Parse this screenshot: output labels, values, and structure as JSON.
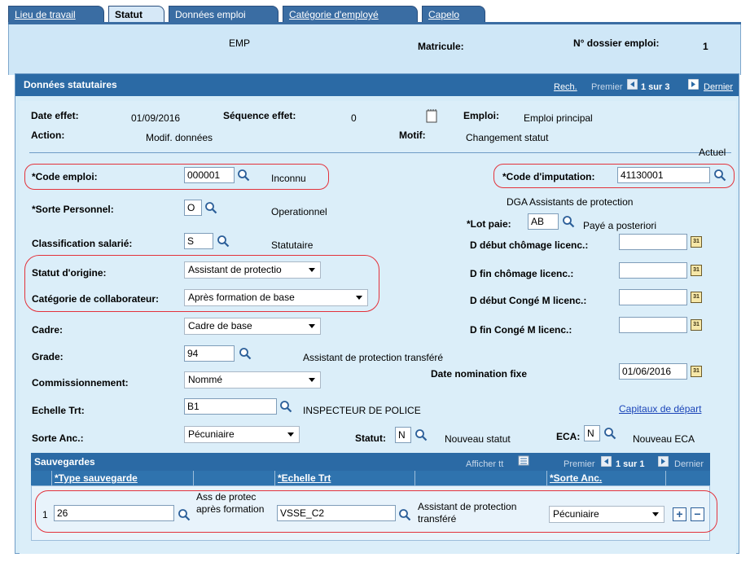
{
  "tabs": [
    "Lieu de travail",
    "Statut",
    "Données emploi",
    "Catégorie d'employé",
    "Capelo"
  ],
  "header": {
    "emp": "EMP",
    "matricule_label": "Matricule:",
    "dossier_label": "N° dossier emploi:",
    "dossier_value": "1"
  },
  "panel": {
    "title": "Données statutaires",
    "rech": "Rech.",
    "premier": "Premier",
    "range": "1 sur 3",
    "dernier": "Dernier"
  },
  "top": {
    "date_effet_label": "Date effet:",
    "date_effet_value": "01/09/2016",
    "sequence_label": "Séquence effet:",
    "sequence_value": "0",
    "emploi_label": "Emploi:",
    "emploi_value": "Emploi principal",
    "action_label": "Action:",
    "action_value": "Modif. données",
    "motif_label": "Motif:",
    "motif_value": "Changement statut",
    "actuel": "Actuel"
  },
  "form": {
    "code_emploi_label": "*Code emploi:",
    "code_emploi_value": "000001",
    "code_emploi_desc": "Inconnu",
    "code_imputation_label": "*Code d'imputation:",
    "code_imputation_value": "41130001",
    "imputation_desc": "DGA Assistants de protection",
    "sorte_personnel_label": "*Sorte Personnel:",
    "sorte_personnel_value": "O",
    "sorte_personnel_desc": "Operationnel",
    "lot_paie_label": "*Lot paie:",
    "lot_paie_value": "AB",
    "lot_paie_desc": "Payé a posteriori",
    "classification_label": "Classification salarié:",
    "classification_value": "S",
    "classification_desc": "Statutaire",
    "d_debut_chomage_label": "D début chômage licenc.:",
    "statut_origine_label": "Statut d'origine:",
    "statut_origine_value": "Assistant de protectio",
    "d_fin_chomage_label": "D fin chômage licenc.:",
    "categorie_label": "Catégorie de collaborateur:",
    "categorie_value": "Après formation de base",
    "d_debut_conge_label": "D début Congé M licenc.:",
    "cadre_label": "Cadre:",
    "cadre_value": "Cadre de base",
    "d_fin_conge_label": "D fin Congé M licenc.:",
    "grade_label": "Grade:",
    "grade_value": "94",
    "grade_desc": "Assistant de protection transféré",
    "commissionnement_label": "Commissionnement:",
    "commissionnement_value": "Nommé",
    "date_nomination_label": "Date nomination fixe",
    "date_nomination_value": "01/06/2016",
    "echelle_label": "Echelle Trt:",
    "echelle_value": "B1",
    "echelle_desc": "INSPECTEUR DE POLICE",
    "capitaux_link": "Capitaux de départ",
    "sorte_anc_label": "Sorte Anc.:",
    "sorte_anc_value": "Pécuniaire",
    "statut_label": "Statut:",
    "statut_value": "N",
    "statut_desc": "Nouveau statut",
    "eca_label": "ECA:",
    "eca_value": "N",
    "eca_desc": "Nouveau ECA"
  },
  "sauvegardes": {
    "title": "Sauvegardes",
    "afficher": "Afficher tt",
    "premier": "Premier",
    "range": "1 sur 1",
    "dernier": "Dernier",
    "col_type": "*Type sauvegarde",
    "col_echelle": "*Echelle Trt",
    "col_sorte": "*Sorte Anc.",
    "row_num": "1",
    "row_type": "26",
    "row_type_desc": "Ass de protec après formation",
    "row_echelle": "VSSE_C2",
    "row_echelle_desc": "Assistant de protection transféré",
    "row_sorte": "Pécuniaire",
    "add": "+",
    "remove": "−"
  },
  "colors": {
    "tab_blue": "#3a6da3",
    "header_blue": "#2b6aa5",
    "oval_red": "#e3323b",
    "panel_bg": "#dbeef9"
  },
  "icons": [
    "search-icon",
    "calendar-icon",
    "first-arrow-icon",
    "next-arrow-icon",
    "memo-icon"
  ]
}
